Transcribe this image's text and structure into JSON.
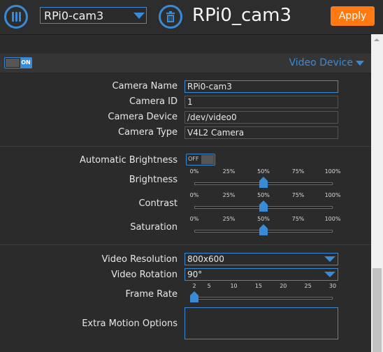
{
  "header": {
    "camera_select": "RPi0-cam3",
    "camera_title": "RPi0_cam3",
    "apply_label": "Apply"
  },
  "section": {
    "toggle_label": "ON",
    "title": "Video Device"
  },
  "fields": {
    "camera_name": {
      "label": "Camera Name",
      "value": "RPi0-cam3"
    },
    "camera_id": {
      "label": "Camera ID",
      "value": "1"
    },
    "camera_device": {
      "label": "Camera Device",
      "value": "/dev/video0"
    },
    "camera_type": {
      "label": "Camera Type",
      "value": "V4L2 Camera"
    }
  },
  "image": {
    "auto_brightness": {
      "label": "Automatic Brightness",
      "toggle_label": "OFF"
    },
    "percent_ticks": [
      "0%",
      "25%",
      "50%",
      "75%",
      "100%"
    ],
    "brightness": {
      "label": "Brightness",
      "value": 50
    },
    "contrast": {
      "label": "Contrast",
      "value": 50
    },
    "saturation": {
      "label": "Saturation",
      "value": 50
    }
  },
  "video": {
    "resolution": {
      "label": "Video Resolution",
      "value": "800x600"
    },
    "rotation": {
      "label": "Video Rotation",
      "value": "90°"
    },
    "frame_rate": {
      "label": "Frame Rate",
      "ticks": [
        "2",
        "5",
        "10",
        "15",
        "20",
        "25",
        "30"
      ],
      "value": 2,
      "min": 2,
      "max": 30
    },
    "extra_motion": {
      "label": "Extra Motion Options",
      "value": ""
    }
  },
  "colors": {
    "accent": "#3a8bd6",
    "apply": "#ff7a12",
    "background": "#2b2b2b"
  }
}
